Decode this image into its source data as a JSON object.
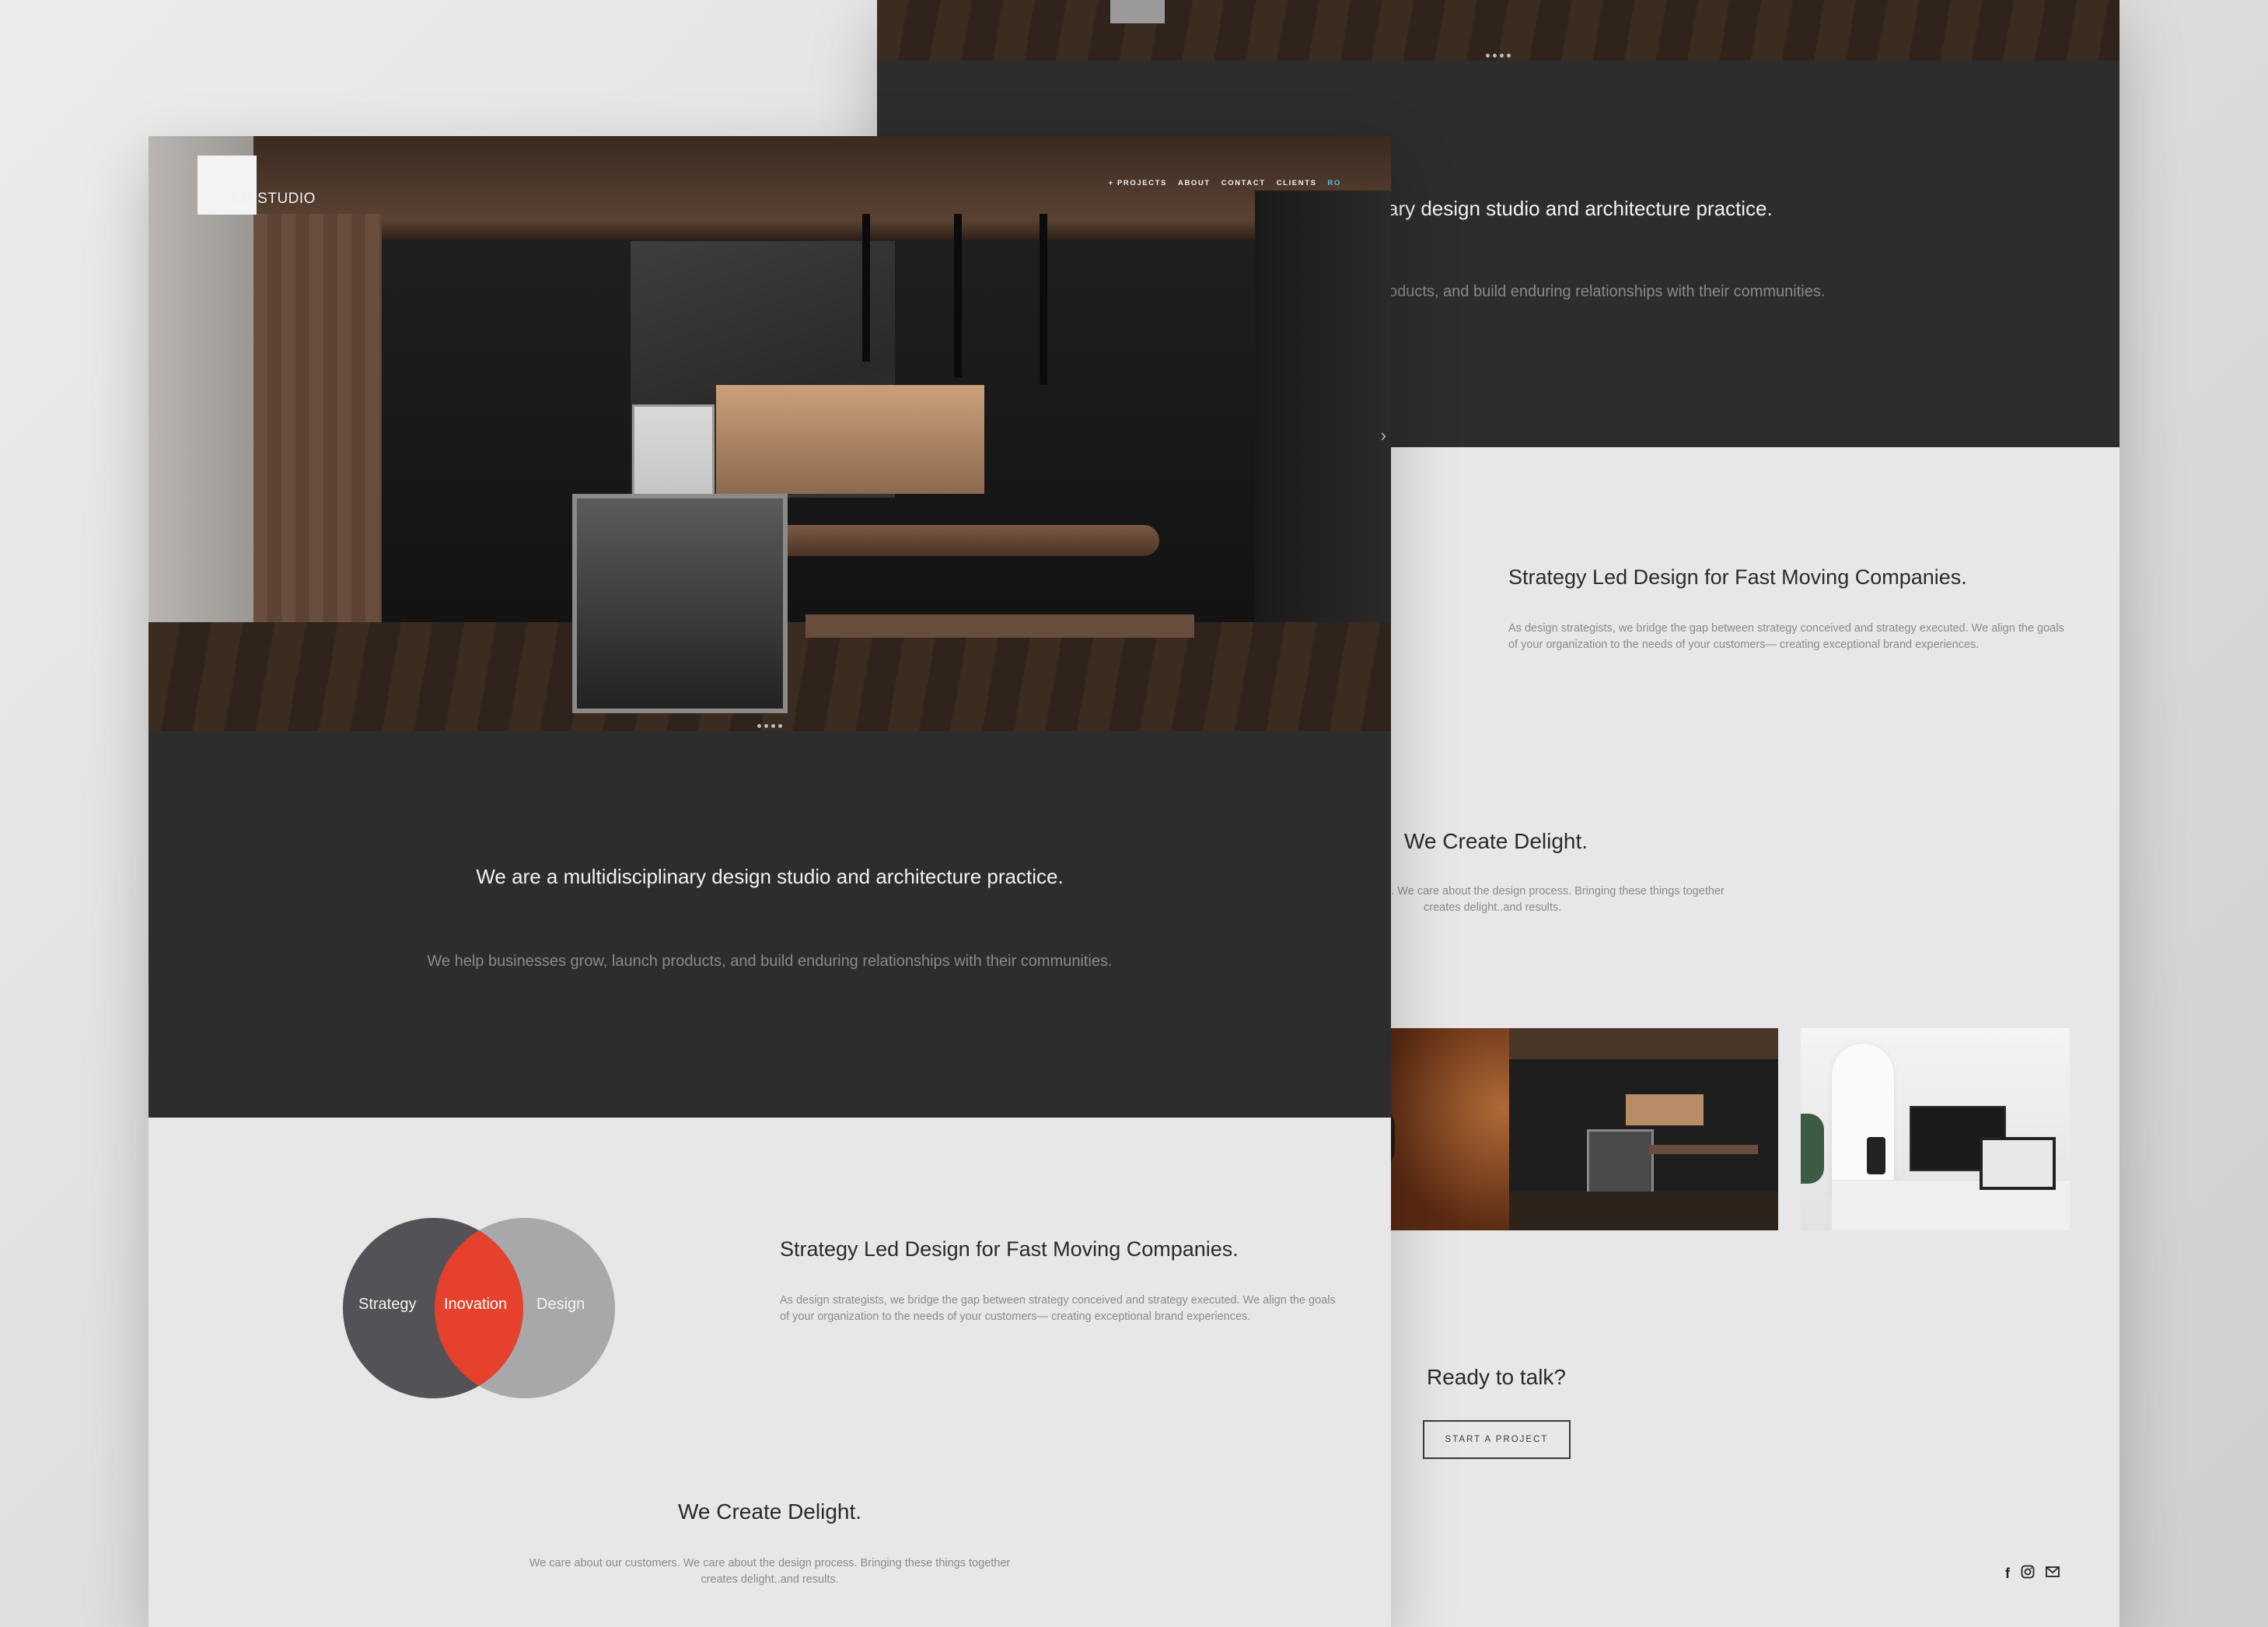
{
  "logo": {
    "text": "CB STUDIO"
  },
  "nav": {
    "items": [
      "+ PROJECTS",
      "ABOUT",
      "CONTACT",
      "CLIENTS"
    ],
    "lang": "RO"
  },
  "carousel": {
    "prev": "‹",
    "next": "›"
  },
  "intro": {
    "title": "We are a multidisciplinary design studio and architecture practice.",
    "subtitle": "We help businesses grow, launch products, and build enduring relationships with their communities.",
    "title_cropped": "ary design studio and architecture practice.",
    "subtitle_cropped": "oducts, and build enduring relationships with their communities."
  },
  "venn": {
    "left": "Strategy",
    "center": "Inovation",
    "right": "Design"
  },
  "strategy": {
    "title": "Strategy Led Design for Fast Moving Companies.",
    "body": "As design strategists, we bridge the gap between strategy conceived and strategy executed. We align the goals of your organization to the needs of your customers— creating exceptional brand experiences."
  },
  "delight": {
    "title": "We Create Delight.",
    "body_line1": "We care about our customers. We care about the design process. Bringing these things together",
    "body_line2": "creates delight..and results.",
    "body_line1_cropped": "s. We care about the design process. Bringing these things together"
  },
  "contact": {
    "title": "Ready to talk?",
    "button": "START A PROJECT"
  },
  "colors": {
    "dark": "#2d2d2d",
    "light": "#e7e7e7",
    "accent": "#e5412d",
    "nav_active": "#4ec3e0"
  },
  "icons": [
    "facebook-icon",
    "instagram-icon",
    "mail-icon"
  ]
}
